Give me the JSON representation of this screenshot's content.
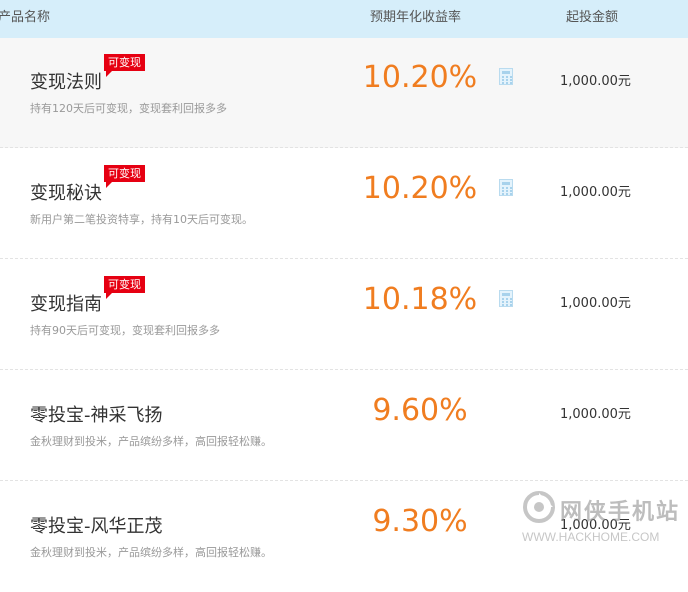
{
  "header": {
    "col_name": "产品名称",
    "col_rate": "预期年化收益率",
    "col_amount": "起投金额"
  },
  "products": [
    {
      "name": "变现法则",
      "tag": "可变现",
      "desc": "持有120天后可变现，变现套利回报多多",
      "rate": "10.20%",
      "amount": "1,000.00元",
      "calculator": true
    },
    {
      "name": "变现秘诀",
      "tag": "可变现",
      "desc": "新用户第二笔投资特享，持有10天后可变现。",
      "rate": "10.20%",
      "amount": "1,000.00元",
      "calculator": true
    },
    {
      "name": "变现指南",
      "tag": "可变现",
      "desc": "持有90天后可变现，变现套利回报多多",
      "rate": "10.18%",
      "amount": "1,000.00元",
      "calculator": true
    },
    {
      "name": "零投宝-神采飞扬",
      "tag": "",
      "desc": "金秋理财到投米，产品缤纷多样，高回报轻松赚。",
      "rate": "9.60%",
      "amount": "1,000.00元",
      "calculator": false
    },
    {
      "name": "零投宝-风华正茂",
      "tag": "",
      "desc": "金秋理财到投米，产品缤纷多样，高回报轻松赚。",
      "rate": "9.30%",
      "amount": "1,000.00元",
      "calculator": false
    }
  ],
  "watermark": {
    "title": "网侠手机站",
    "url": "WWW.HACKHOME.COM"
  },
  "colors": {
    "header_bg": "#d6eefa",
    "rate": "#f07d20",
    "tag_bg": "#e60012"
  },
  "icons": {
    "calculator": "calculator-icon",
    "watermark_logo": "hackhome-logo-icon"
  }
}
